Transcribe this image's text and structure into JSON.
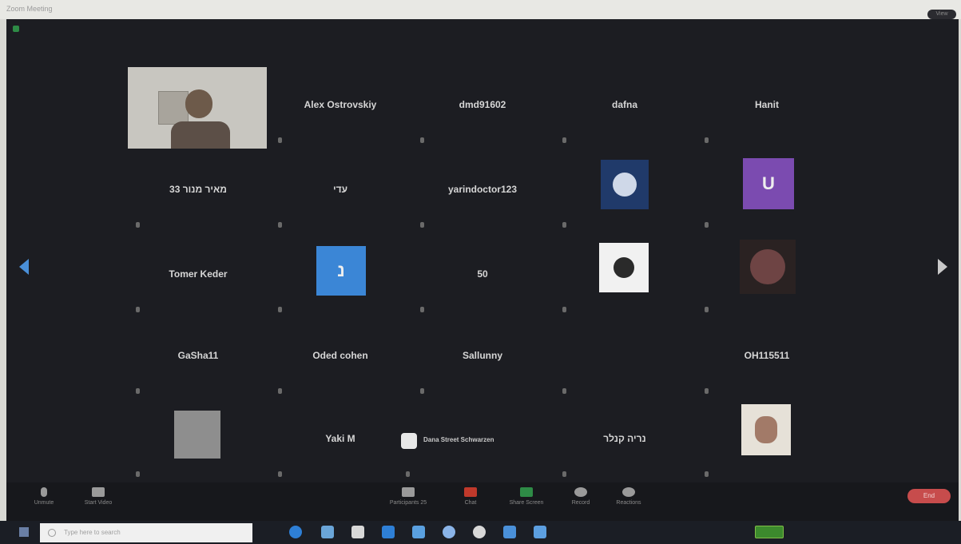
{
  "window": {
    "title": "Zoom Meeting",
    "badge": "View"
  },
  "participants": [
    {
      "name": ""
    },
    {
      "name": "Alex Ostrovskiy"
    },
    {
      "name": "dmd91602"
    },
    {
      "name": "dafna"
    },
    {
      "name": "Hanit"
    },
    {
      "name": "מאיר מנור 33"
    },
    {
      "name": "עדי"
    },
    {
      "name": "yarindoctor123"
    },
    {
      "name": ""
    },
    {
      "name": "",
      "avatar_letter": "U"
    },
    {
      "name": "Tomer Keder"
    },
    {
      "name": "",
      "avatar_letter": "נ"
    },
    {
      "name": "50"
    },
    {
      "name": ""
    },
    {
      "name": ""
    },
    {
      "name": "GaSha11"
    },
    {
      "name": "Oded cohen"
    },
    {
      "name": "Sallunny"
    },
    {
      "name": ""
    },
    {
      "name": "OH115511"
    },
    {
      "name": ""
    },
    {
      "name": "Yaki M"
    },
    {
      "name": "Dana Street Schwarzen"
    },
    {
      "name": "נריה קנלר"
    },
    {
      "name": ""
    }
  ],
  "toolbar": {
    "mute": "Unmute",
    "video": "Start Video",
    "participants": "Participants",
    "participants_count": "25",
    "chat": "Chat",
    "share": "Share Screen",
    "record": "Record",
    "reactions": "Reactions",
    "end": "End"
  },
  "taskbar": {
    "search_placeholder": "Type here to search"
  },
  "colors": {
    "stage": "#1c1d22",
    "accent_blue": "#4a90d9",
    "end_red": "#c74c4c",
    "avatar_purple": "#7b4bb0",
    "avatar_blue": "#3b86d6"
  },
  "icons": [
    "grid-icon",
    "mic-icon",
    "camera-icon",
    "participants-icon",
    "chat-icon",
    "share-icon",
    "record-icon",
    "reactions-icon",
    "windows-icon",
    "search-icon",
    "battery-icon"
  ]
}
